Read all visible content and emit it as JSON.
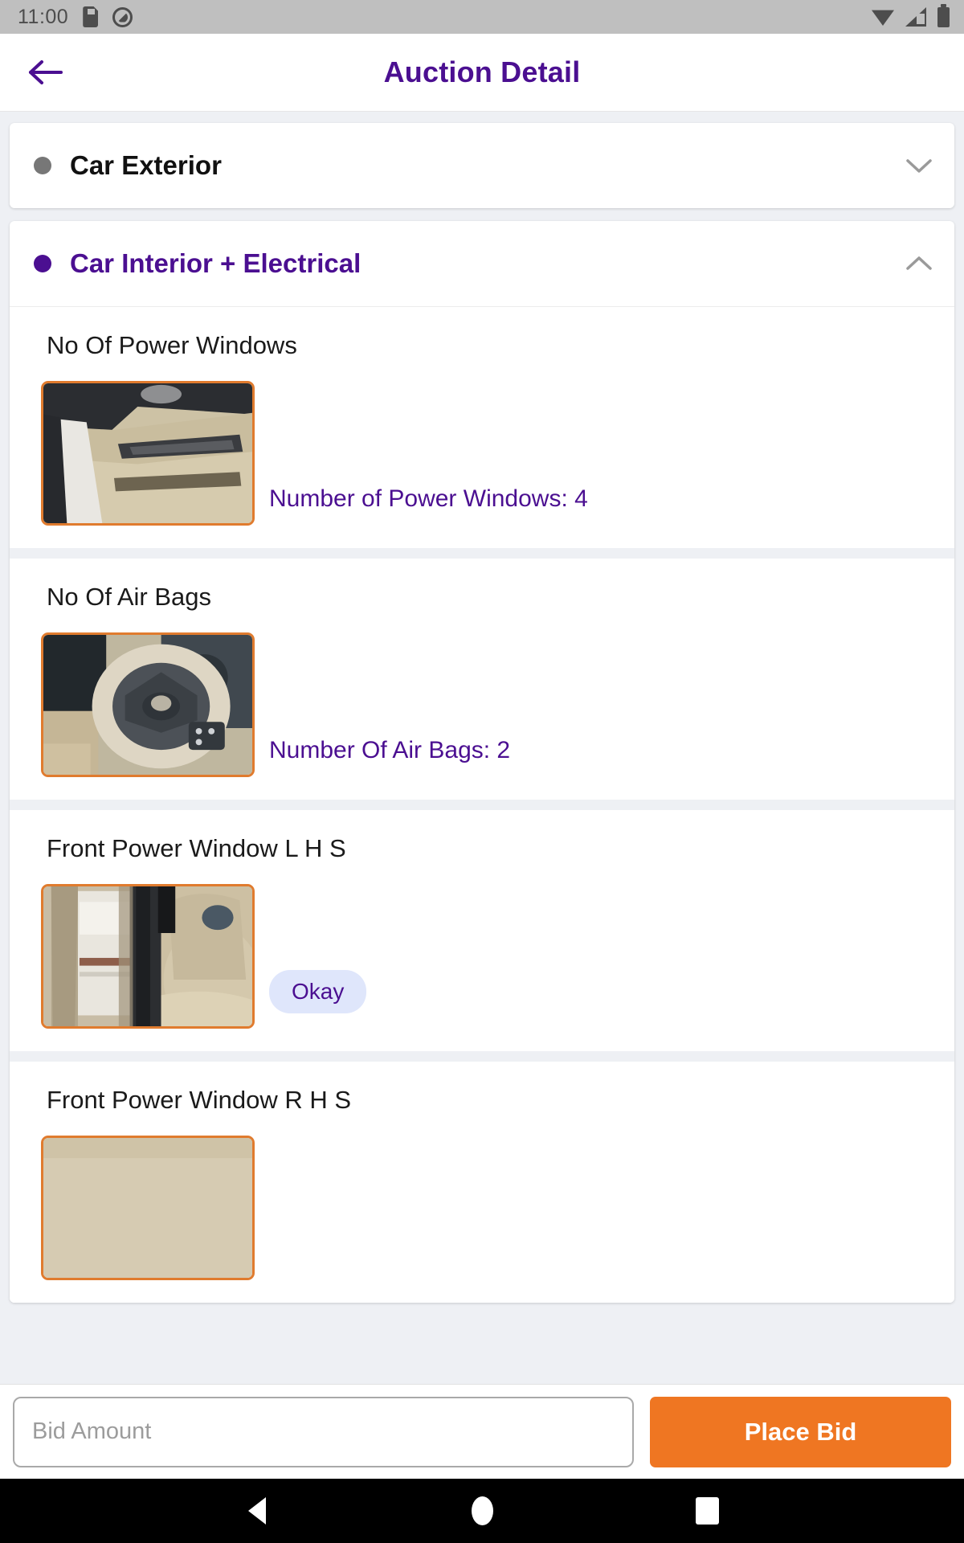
{
  "status_bar": {
    "time": "11:00",
    "icons_left": [
      "sd-card-icon",
      "do-not-disturb-icon"
    ],
    "icons_right": [
      "wifi-icon",
      "cellular-signal-icon",
      "battery-icon"
    ]
  },
  "app_bar": {
    "back_icon": "arrow-left-icon",
    "title": "Auction Detail"
  },
  "colors": {
    "brand_purple": "#4B0F91",
    "accent_orange": "#EF7622",
    "thumb_border": "#E07B2E",
    "pill_bg": "#DFE6FB",
    "page_bg": "#EEF0F4"
  },
  "sections": [
    {
      "title": "Car Exterior",
      "expanded": false,
      "bullet": "grey",
      "chevron": "chevron-down-icon",
      "items": []
    },
    {
      "title": "Car Interior + Electrical",
      "expanded": true,
      "bullet": "purple",
      "chevron": "chevron-up-icon",
      "items": [
        {
          "label": "No Of Power Windows",
          "value": "Number of Power Windows: 4",
          "value_type": "text",
          "thumb": "car-door-panel-photo"
        },
        {
          "label": "No Of Air Bags",
          "value": "Number Of Air Bags: 2",
          "value_type": "text",
          "thumb": "steering-wheel-photo"
        },
        {
          "label": "Front Power Window L H S",
          "value": "Okay",
          "value_type": "pill",
          "thumb": "car-seats-photo"
        },
        {
          "label": "Front Power Window R H S",
          "value": "",
          "value_type": "none",
          "thumb": "car-interior-photo"
        }
      ]
    }
  ],
  "bid_bar": {
    "input_placeholder": "Bid Amount",
    "input_value": "",
    "button_label": "Place Bid"
  },
  "nav_bar": {
    "back": "nav-back-icon",
    "home": "nav-home-icon",
    "recents": "nav-recents-icon"
  }
}
